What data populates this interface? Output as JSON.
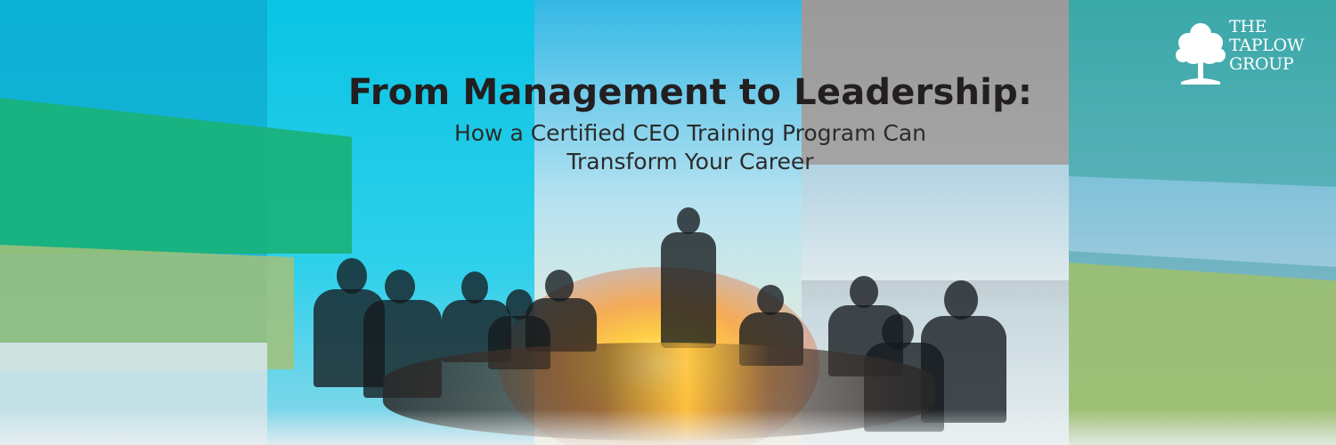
{
  "banner": {
    "title": "From Management to Leadership:",
    "subtitle_line1": "How a Certified CEO Training Program Can",
    "subtitle_line2": "Transform Your Career"
  },
  "logo": {
    "line1": "THE",
    "line2": "TAPLOW",
    "line3": "GROUP",
    "icon": "tree-icon"
  },
  "colors": {
    "title": "#231f20",
    "cyan": "#0ac4e4",
    "green": "#1ab27a",
    "olive": "#a4c17a",
    "gray": "#9a9a9a",
    "teal": "#3aa8a8"
  }
}
